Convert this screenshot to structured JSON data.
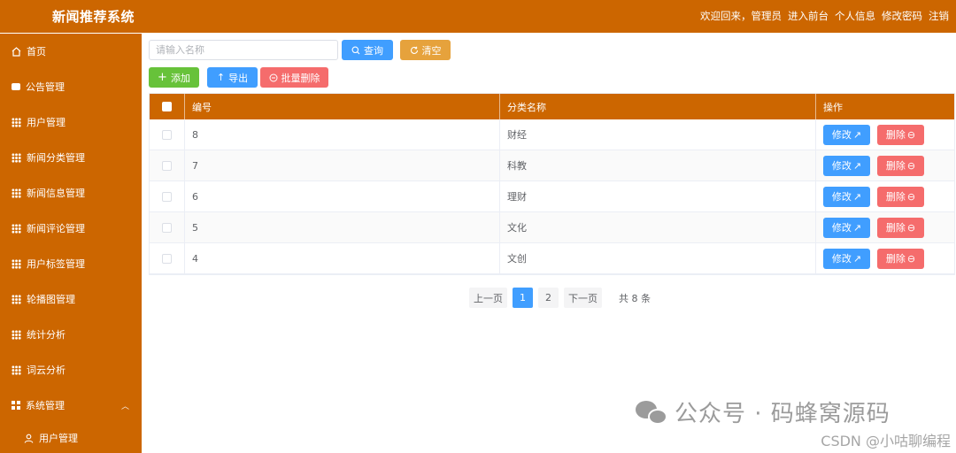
{
  "header": {
    "title": "新闻推荐系统",
    "links": [
      "欢迎回来，管理员",
      "进入前台",
      "个人信息",
      "修改密码",
      "注销"
    ]
  },
  "sidebar": {
    "items": [
      {
        "label": "首页",
        "icon": "home-icon"
      },
      {
        "label": "公告管理",
        "icon": "message-icon"
      },
      {
        "label": "用户管理",
        "icon": "grid-icon"
      },
      {
        "label": "新闻分类管理",
        "icon": "grid-icon"
      },
      {
        "label": "新闻信息管理",
        "icon": "grid-icon"
      },
      {
        "label": "新闻评论管理",
        "icon": "grid-icon"
      },
      {
        "label": "用户标签管理",
        "icon": "grid-icon"
      },
      {
        "label": "轮播图管理",
        "icon": "grid-icon"
      },
      {
        "label": "统计分析",
        "icon": "grid-icon"
      },
      {
        "label": "词云分析",
        "icon": "grid-icon"
      },
      {
        "label": "系统管理",
        "icon": "menu-icon",
        "expanded": true
      }
    ],
    "subitems": [
      {
        "label": "用户管理",
        "icon": "user-icon"
      }
    ]
  },
  "toolbar": {
    "search_placeholder": "请输入名称",
    "search_value": "",
    "query_label": "查询",
    "clear_label": "清空",
    "add_label": "添加",
    "export_label": "导出",
    "batch_delete_label": "批量删除"
  },
  "table": {
    "columns": [
      "编号",
      "分类名称",
      "操作"
    ],
    "rows": [
      {
        "id": "8",
        "name": "财经"
      },
      {
        "id": "7",
        "name": "科教"
      },
      {
        "id": "6",
        "name": "理财"
      },
      {
        "id": "5",
        "name": "文化"
      },
      {
        "id": "4",
        "name": "文创"
      }
    ],
    "edit_label": "修改",
    "delete_label": "删除"
  },
  "pagination": {
    "prev_label": "上一页",
    "pages": [
      "1",
      "2"
    ],
    "current": "1",
    "next_label": "下一页",
    "total_label": "共 8 条"
  },
  "watermark": {
    "text": "公众号 · 码蜂窝源码",
    "csdn": "CSDN @小咕聊编程"
  },
  "colors": {
    "brand": "#cc6600",
    "primary": "#409eff",
    "success": "#67c23a",
    "warning": "#e6a23c",
    "danger": "#f56c6c"
  }
}
